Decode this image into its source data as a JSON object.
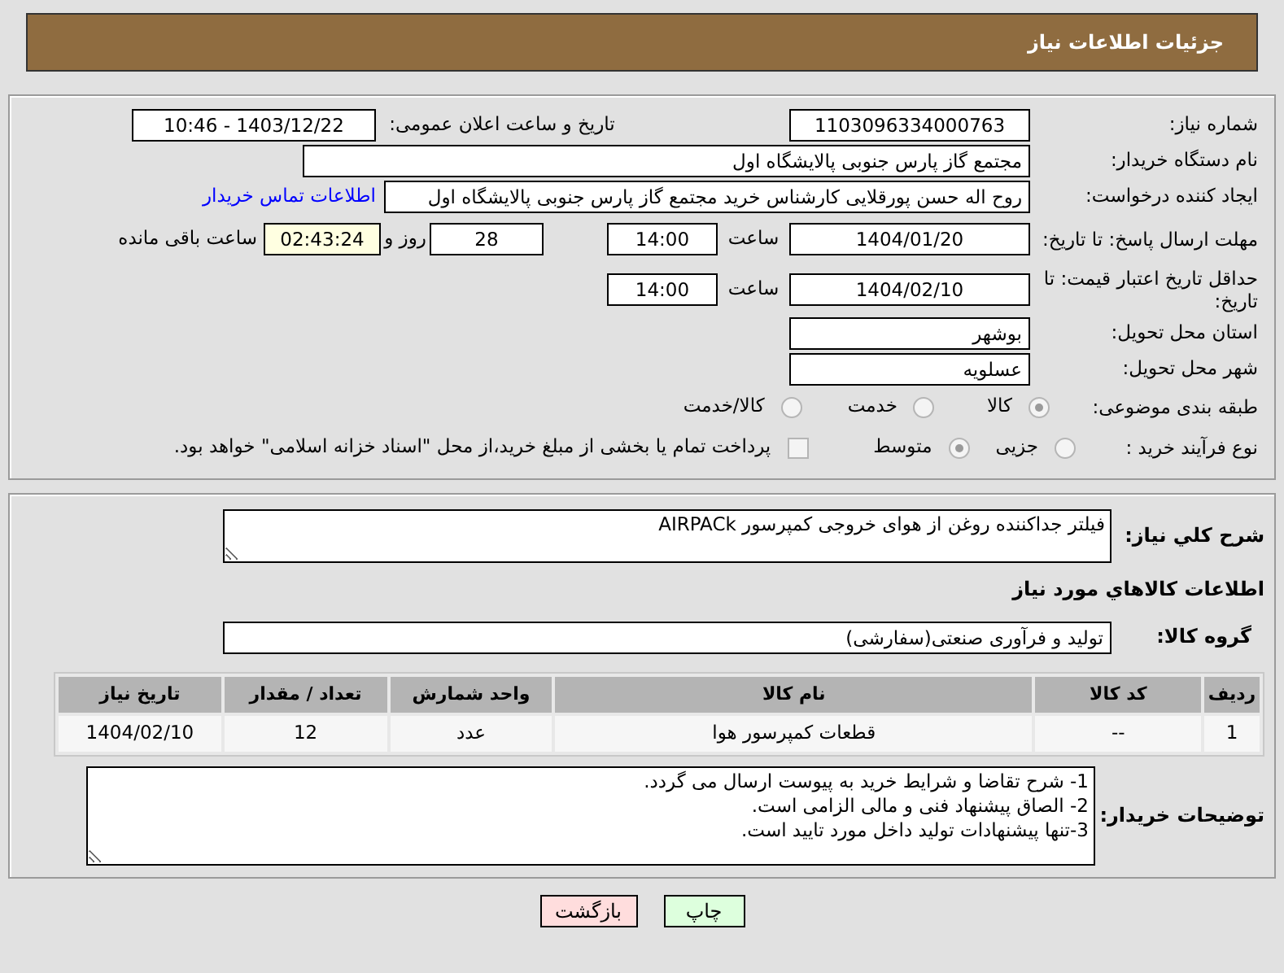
{
  "page_title": "جزئیات اطلاعات نیاز",
  "need_number": {
    "label": "شماره نیاز:",
    "value": "1103096334000763"
  },
  "announce": {
    "label": "تاریخ و ساعت اعلان عمومی:",
    "value": "1403/12/22 - 10:46"
  },
  "buyer_org": {
    "label": "نام دستگاه خریدار:",
    "value": "مجتمع گاز پارس جنوبی  پالایشگاه اول"
  },
  "requester": {
    "label": "ایجاد کننده درخواست:",
    "value": "روح اله حسن پورقلایی کارشناس خرید مجتمع گاز پارس جنوبی  پالایشگاه اول",
    "contact_link": "اطلاعات تماس خریدار"
  },
  "reply_deadline": {
    "label": "مهلت ارسال پاسخ: تا تاریخ:",
    "date": "1404/01/20",
    "time_label": "ساعت",
    "time": "14:00",
    "days": "28",
    "days_label": "روز و",
    "remaining": "02:43:24",
    "remaining_label": "ساعت باقی مانده"
  },
  "price_validity": {
    "label": "حداقل تاریخ اعتبار قیمت: تا تاریخ:",
    "date": "1404/02/10",
    "time_label": "ساعت",
    "time": "14:00"
  },
  "province": {
    "label": "استان محل تحویل:",
    "value": "بوشهر"
  },
  "city": {
    "label": "شهر محل تحویل:",
    "value": "عسلویه"
  },
  "category": {
    "label": "طبقه بندی موضوعی:",
    "options": [
      {
        "label": "کالا",
        "selected": true
      },
      {
        "label": "خدمت",
        "selected": false
      },
      {
        "label": "کالا/خدمت",
        "selected": false
      }
    ]
  },
  "process": {
    "label": "نوع فرآیند خرید :",
    "options": [
      {
        "label": "جزیی",
        "selected": false
      },
      {
        "label": "متوسط",
        "selected": true
      }
    ],
    "treasury": {
      "label": "پرداخت تمام یا بخشی از مبلغ خرید،از محل \"اسناد خزانه اسلامی\" خواهد بود.",
      "checked": false
    }
  },
  "description": {
    "label": "شرح کلي نياز:",
    "value": "فیلتر جداکننده روغن از هوای خروجی کمپرسور AIRPACk"
  },
  "goods_heading": "اطلاعات كالاهاي مورد نياز",
  "goods_group": {
    "label": "گروه کالا:",
    "value": "تولید و فرآوری صنعتی(سفارشی)"
  },
  "table": {
    "columns": [
      "ردیف",
      "کد کالا",
      "نام کالا",
      "واحد شمارش",
      "تعداد / مقدار",
      "تاریخ نیاز"
    ],
    "rows": [
      [
        "1",
        "--",
        "قطعات کمپرسور هوا",
        "عدد",
        "12",
        "1404/02/10"
      ]
    ]
  },
  "buyer_notes": {
    "label": "توضیحات خریدار:",
    "lines": [
      "1- شرح تقاضا و شرایط خرید به پیوست ارسال می گردد.",
      "2- الصاق پیشنهاد فنی و مالی الزامی است.",
      "3-تنها پیشنهادات تولید داخل مورد تایید است."
    ]
  },
  "buttons": [
    {
      "label": "چاپ",
      "kind": "print"
    },
    {
      "label": "بازگشت",
      "kind": "back"
    }
  ]
}
